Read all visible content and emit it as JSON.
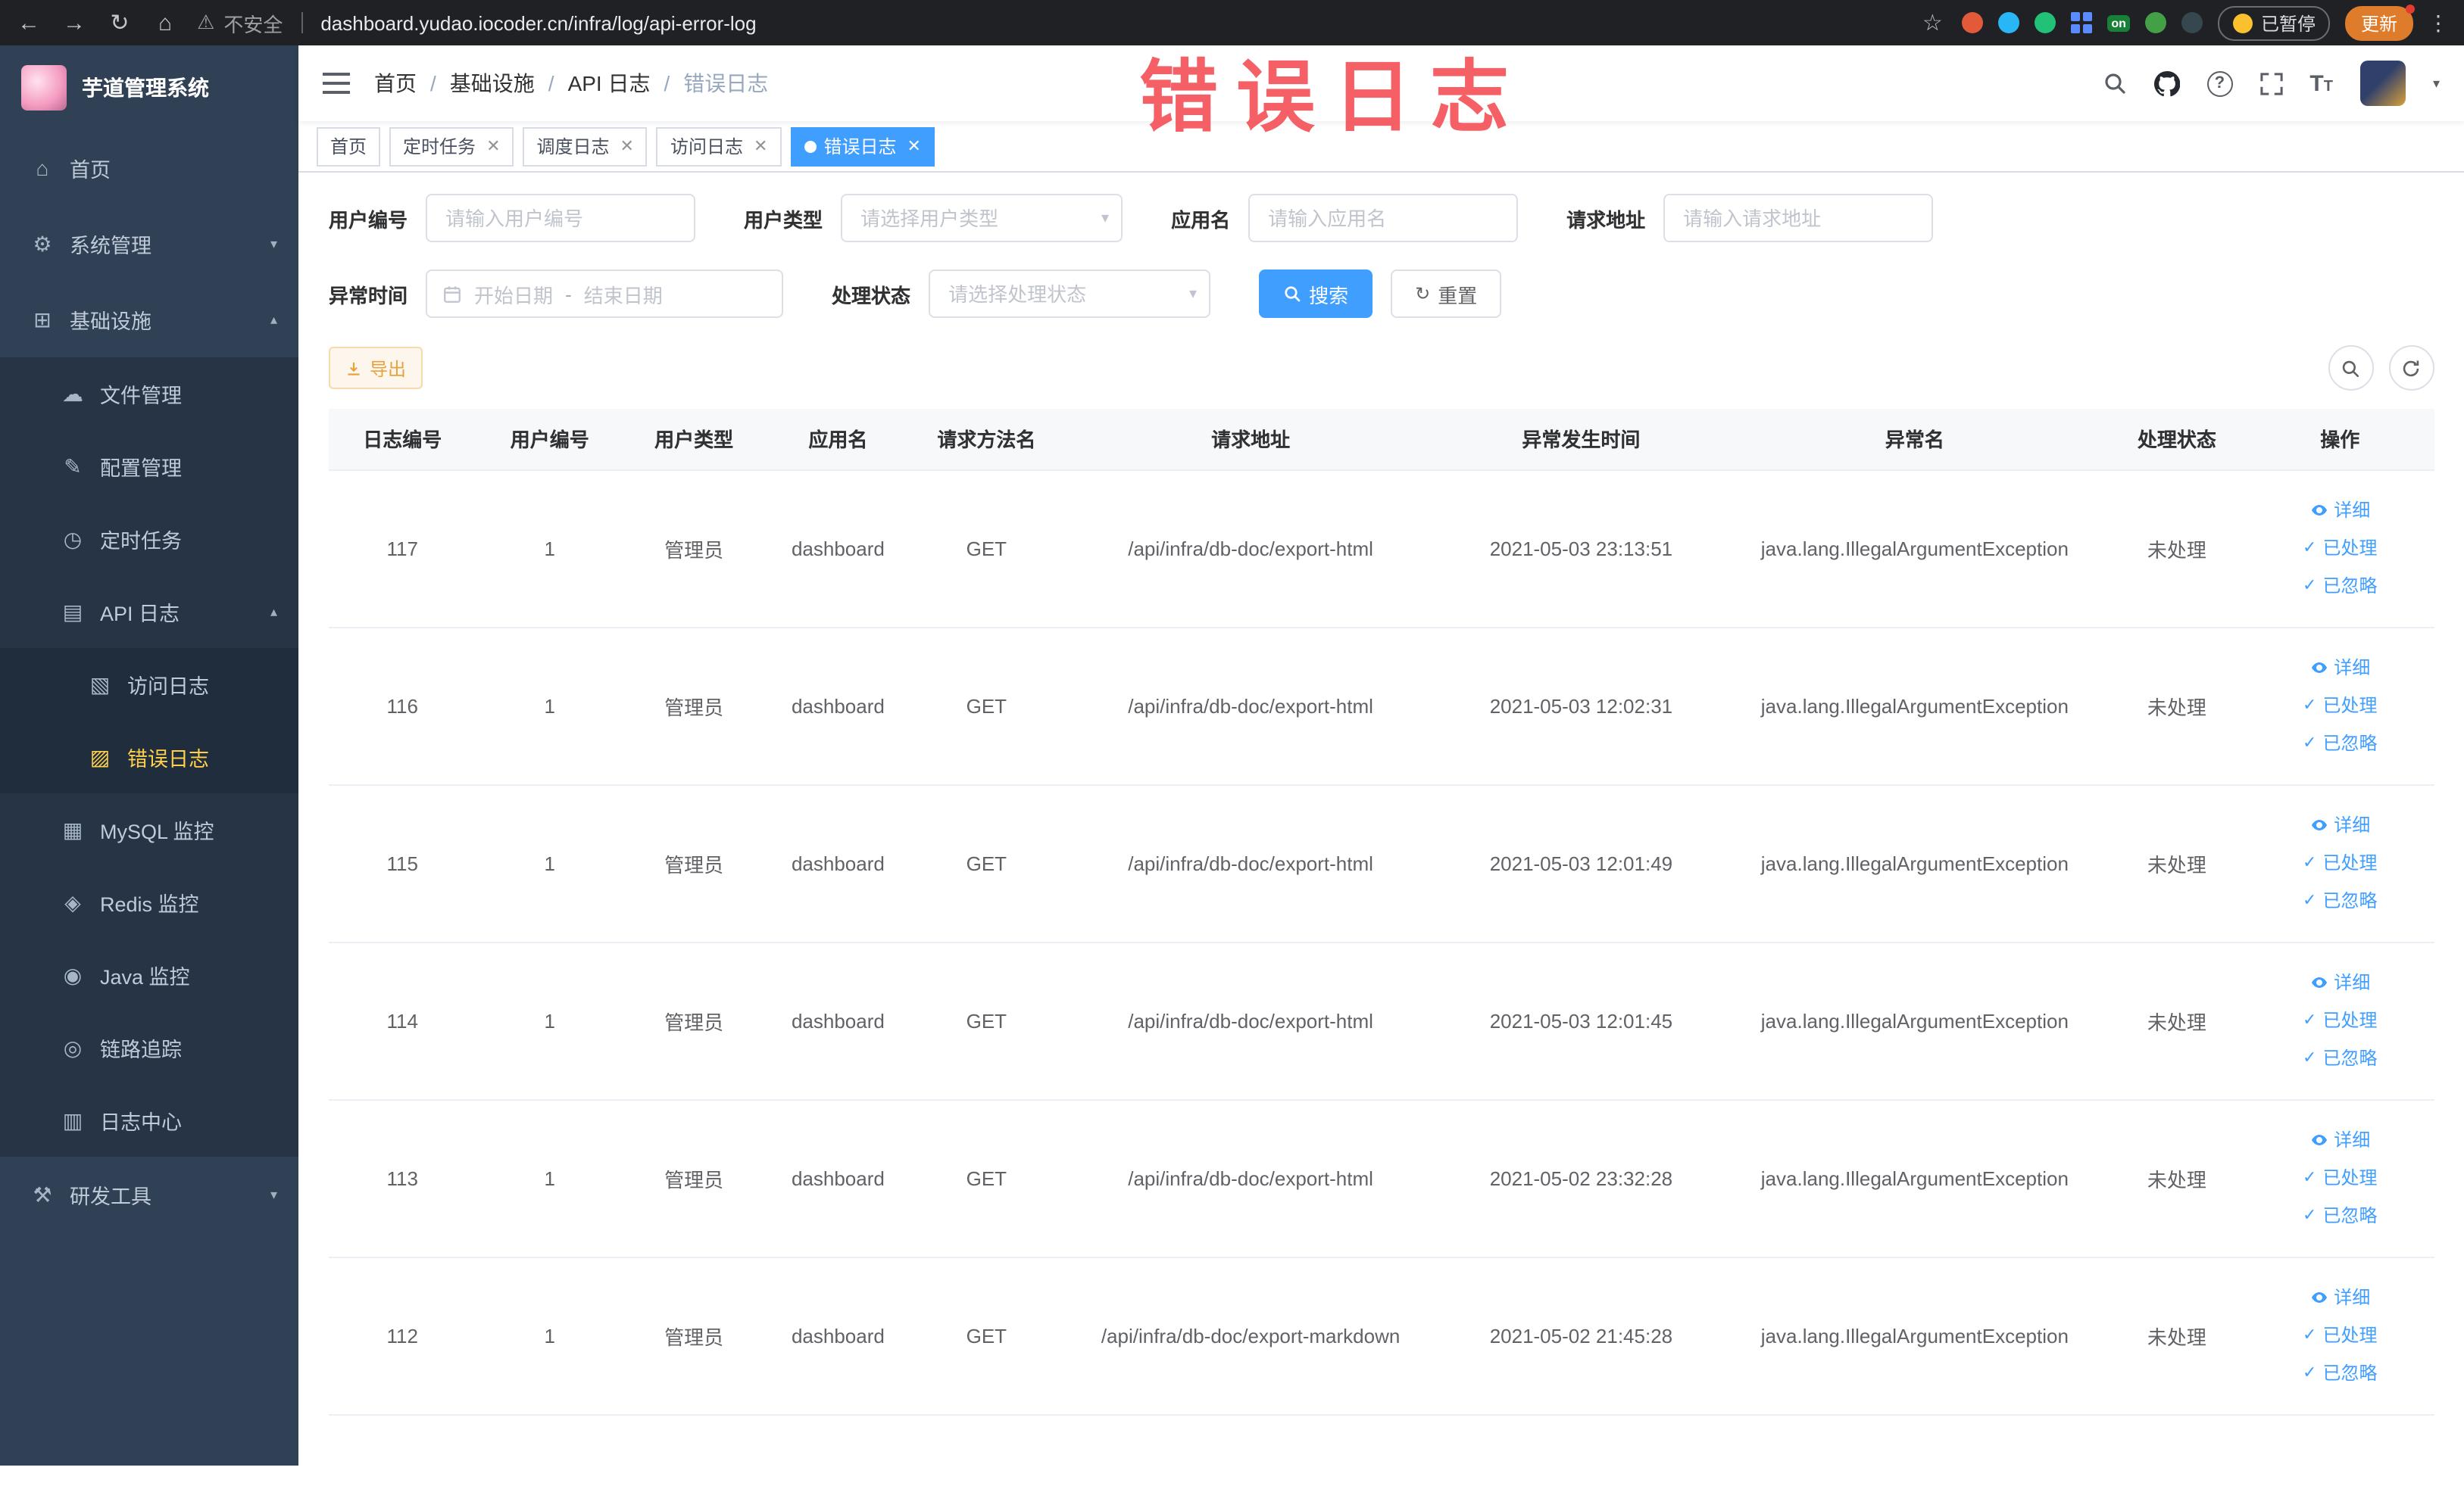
{
  "browser": {
    "security_label": "不安全",
    "url": "dashboard.yudao.iocoder.cn/infra/log/api-error-log",
    "paused_label": "已暂停",
    "update_label": "更新"
  },
  "sidebar": {
    "title": "芋道管理系统",
    "items": [
      {
        "label": "首页"
      },
      {
        "label": "系统管理"
      },
      {
        "label": "基础设施"
      },
      {
        "label": "文件管理"
      },
      {
        "label": "配置管理"
      },
      {
        "label": "定时任务"
      },
      {
        "label": "API 日志"
      },
      {
        "label": "访问日志"
      },
      {
        "label": "错误日志"
      },
      {
        "label": "MySQL 监控"
      },
      {
        "label": "Redis 监控"
      },
      {
        "label": "Java 监控"
      },
      {
        "label": "链路追踪"
      },
      {
        "label": "日志中心"
      },
      {
        "label": "研发工具"
      }
    ]
  },
  "header": {
    "breadcrumb": [
      "首页",
      "基础设施",
      "API 日志",
      "错误日志"
    ],
    "watermark": "错误日志"
  },
  "tabs": [
    {
      "label": "首页"
    },
    {
      "label": "定时任务"
    },
    {
      "label": "调度日志"
    },
    {
      "label": "访问日志"
    },
    {
      "label": "错误日志"
    }
  ],
  "filters": {
    "user_id": {
      "label": "用户编号",
      "placeholder": "请输入用户编号"
    },
    "user_type": {
      "label": "用户类型",
      "placeholder": "请选择用户类型"
    },
    "app_name": {
      "label": "应用名",
      "placeholder": "请输入应用名"
    },
    "request_url": {
      "label": "请求地址",
      "placeholder": "请输入请求地址"
    },
    "exception_time": {
      "label": "异常时间",
      "start_placeholder": "开始日期",
      "separator": "-",
      "end_placeholder": "结束日期"
    },
    "process_status": {
      "label": "处理状态",
      "placeholder": "请选择处理状态"
    },
    "search_label": "搜索",
    "reset_label": "重置"
  },
  "toolbar": {
    "export_label": "导出"
  },
  "table": {
    "headers": [
      "日志编号",
      "用户编号",
      "用户类型",
      "应用名",
      "请求方法名",
      "请求地址",
      "异常发生时间",
      "异常名",
      "处理状态",
      "操作"
    ],
    "actions": {
      "detail": "详细",
      "process": "已处理",
      "ignore": "已忽略"
    },
    "rows": [
      {
        "log_id": "117",
        "user_id": "1",
        "user_type": "管理员",
        "app_name": "dashboard",
        "method": "GET",
        "url": "/api/infra/db-doc/export-html",
        "time": "2021-05-03 23:13:51",
        "exception": "java.lang.IllegalArgumentException",
        "status": "未处理"
      },
      {
        "log_id": "116",
        "user_id": "1",
        "user_type": "管理员",
        "app_name": "dashboard",
        "method": "GET",
        "url": "/api/infra/db-doc/export-html",
        "time": "2021-05-03 12:02:31",
        "exception": "java.lang.IllegalArgumentException",
        "status": "未处理"
      },
      {
        "log_id": "115",
        "user_id": "1",
        "user_type": "管理员",
        "app_name": "dashboard",
        "method": "GET",
        "url": "/api/infra/db-doc/export-html",
        "time": "2021-05-03 12:01:49",
        "exception": "java.lang.IllegalArgumentException",
        "status": "未处理"
      },
      {
        "log_id": "114",
        "user_id": "1",
        "user_type": "管理员",
        "app_name": "dashboard",
        "method": "GET",
        "url": "/api/infra/db-doc/export-html",
        "time": "2021-05-03 12:01:45",
        "exception": "java.lang.IllegalArgumentException",
        "status": "未处理"
      },
      {
        "log_id": "113",
        "user_id": "1",
        "user_type": "管理员",
        "app_name": "dashboard",
        "method": "GET",
        "url": "/api/infra/db-doc/export-html",
        "time": "2021-05-02 23:32:28",
        "exception": "java.lang.IllegalArgumentException",
        "status": "未处理"
      },
      {
        "log_id": "112",
        "user_id": "1",
        "user_type": "管理员",
        "app_name": "dashboard",
        "method": "GET",
        "url": "/api/infra/db-doc/export-markdown",
        "time": "2021-05-02 21:45:28",
        "exception": "java.lang.IllegalArgumentException",
        "status": "未处理"
      }
    ]
  }
}
